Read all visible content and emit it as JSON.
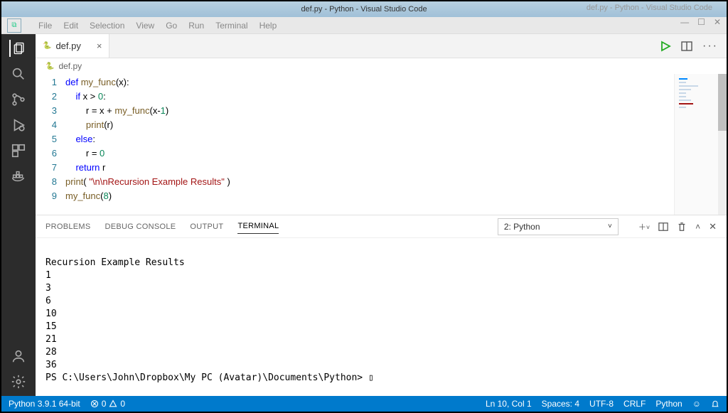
{
  "window": {
    "title": "def.py - Python - Visual Studio Code",
    "ghost_title": "def.py - Python - Visual Studio Code"
  },
  "menubar": {
    "items": [
      "File",
      "Edit",
      "Selection",
      "View",
      "Go",
      "Run",
      "Terminal",
      "Help"
    ]
  },
  "tab": {
    "filename": "def.py",
    "close_glyph": "×"
  },
  "breadcrumb": {
    "filename": "def.py"
  },
  "code": {
    "lines": [
      "1",
      "2",
      "3",
      "4",
      "5",
      "6",
      "7",
      "8",
      "9"
    ],
    "tokens": [
      [
        {
          "t": "def ",
          "c": "kw"
        },
        {
          "t": "my_func",
          "c": "fn"
        },
        {
          "t": "(x):",
          "c": ""
        }
      ],
      [
        {
          "t": "    ",
          "c": ""
        },
        {
          "t": "if",
          "c": "kw"
        },
        {
          "t": " x > ",
          "c": ""
        },
        {
          "t": "0",
          "c": "num"
        },
        {
          "t": ":",
          "c": ""
        }
      ],
      [
        {
          "t": "        r = x + ",
          "c": ""
        },
        {
          "t": "my_func",
          "c": "fn"
        },
        {
          "t": "(x-",
          "c": ""
        },
        {
          "t": "1",
          "c": "num"
        },
        {
          "t": ")",
          "c": ""
        }
      ],
      [
        {
          "t": "        ",
          "c": ""
        },
        {
          "t": "print",
          "c": "fn"
        },
        {
          "t": "(r)",
          "c": ""
        }
      ],
      [
        {
          "t": "    ",
          "c": ""
        },
        {
          "t": "else",
          "c": "kw"
        },
        {
          "t": ":",
          "c": ""
        }
      ],
      [
        {
          "t": "        r = ",
          "c": ""
        },
        {
          "t": "0",
          "c": "num"
        }
      ],
      [
        {
          "t": "    ",
          "c": ""
        },
        {
          "t": "return",
          "c": "kw"
        },
        {
          "t": " r",
          "c": ""
        }
      ],
      [
        {
          "t": "print",
          "c": "fn"
        },
        {
          "t": "( ",
          "c": ""
        },
        {
          "t": "\"\\n\\nRecursion Example Results\"",
          "c": "str"
        },
        {
          "t": " )",
          "c": ""
        }
      ],
      [
        {
          "t": "my_func",
          "c": "fn"
        },
        {
          "t": "(",
          "c": ""
        },
        {
          "t": "8",
          "c": "num"
        },
        {
          "t": ")",
          "c": ""
        }
      ]
    ]
  },
  "panel": {
    "tabs": [
      "PROBLEMS",
      "DEBUG CONSOLE",
      "OUTPUT",
      "TERMINAL"
    ],
    "active_tab": "TERMINAL",
    "terminal_select": "2: Python",
    "output_lines": [
      "",
      "Recursion Example Results",
      "1",
      "3",
      "6",
      "10",
      "15",
      "21",
      "28",
      "36"
    ],
    "prompt": "PS C:\\Users\\John\\Dropbox\\My PC (Avatar)\\Documents\\Python> ",
    "cursor": "▯"
  },
  "statusbar": {
    "interpreter": "Python 3.9.1 64-bit",
    "errors": "0",
    "warnings": "0",
    "cursor": "Ln 10, Col 1",
    "spaces": "Spaces: 4",
    "encoding": "UTF-8",
    "eol": "CRLF",
    "language": "Python",
    "feedback_glyph": "☺"
  }
}
